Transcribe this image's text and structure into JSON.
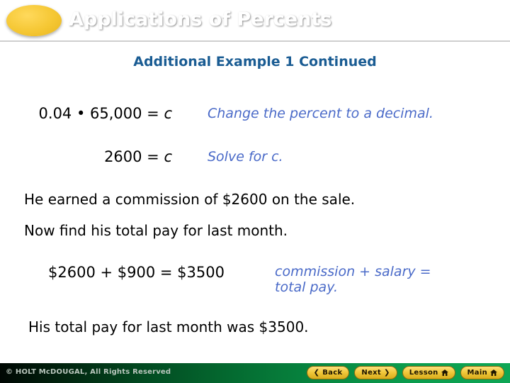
{
  "header": {
    "title": "Applications of Percents",
    "ellipse_color": "#f5c733",
    "bar_color_dark": "#000a04",
    "bar_color_bright": "#089247"
  },
  "subtitle": "Additional Example 1 Continued",
  "accent_blue": "#4a6ac8",
  "subtitle_blue": "#1a5c93",
  "content": {
    "equation1": {
      "expression": "0.04 • 65,000 = ",
      "variable": "c",
      "note": "Change the percent to a decimal."
    },
    "equation2": {
      "expression": "2600 = ",
      "variable": "c",
      "note": "Solve for c."
    },
    "statement1": "He earned a commission of $2600 on the sale.",
    "statement2": "Now find his total pay for last month.",
    "sum": {
      "expression": "$2600 + $900 = $3500",
      "note_line1": "commission + salary =",
      "note_line2": "total pay."
    },
    "conclusion": "His total pay for last month was $3500."
  },
  "footer": {
    "copyright": "© HOLT McDOUGAL, All Rights Reserved",
    "buttons": [
      {
        "label": "Back",
        "icon": "chevron-left",
        "glyph": "❮"
      },
      {
        "label": "Next",
        "icon": "chevron-right",
        "glyph": "❯"
      },
      {
        "label": "Lesson",
        "icon": "home",
        "glyph": ""
      },
      {
        "label": "Main",
        "icon": "home",
        "glyph": ""
      }
    ]
  }
}
